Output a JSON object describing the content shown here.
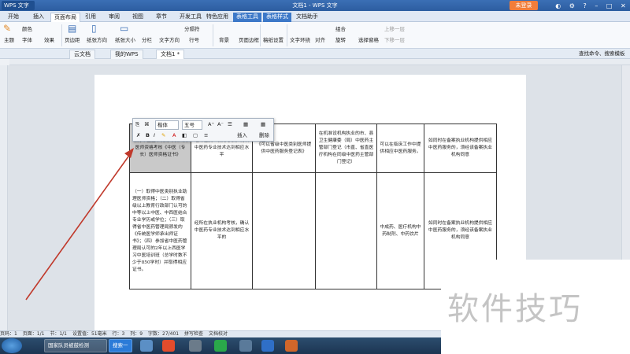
{
  "app": {
    "name": "WPS 文字",
    "doc_title": "文档1 - WPS 文字",
    "login": "未登录"
  },
  "menu_tabs": [
    "开始",
    "插入",
    "页面布局",
    "引用",
    "审阅",
    "视图",
    "章节",
    "开发工具",
    "特色应用",
    "表格工具",
    "表格样式",
    "文档助手"
  ],
  "ribbon": {
    "theme": "主题",
    "color": "颜色",
    "font": "字体",
    "effect": "效果",
    "margins": "页边距",
    "orientation": "纸张方向",
    "size": "纸张大小",
    "columns": "分栏",
    "text_dir": "文字方向",
    "breaks": "分隔符",
    "line_no": "行号",
    "background": "背景",
    "page_border": "页面边框",
    "draft": "稿纸设置",
    "wrap": "文字环绕",
    "align": "对齐",
    "rotate": "旋转",
    "group": "组合",
    "select_pane": "选择窗格",
    "up": "上移一层",
    "down": "下移一层"
  },
  "quickbar": {
    "tabs": [
      "云文档",
      "我的WPS",
      "文档1 *"
    ],
    "search": "查找命令、搜索模板"
  },
  "mini_toolbar": {
    "font": "楷体",
    "size": "五号",
    "insert": "插入",
    "delete": "删除"
  },
  "table": {
    "row1": [
      "取得中医医术确有专长人员医师资格考核《中医（专长）医师资格证书》",
      "经所在执业机构考核，确认中医药专业技术达到相应水平",
      "《可以省级中医类别医师提供中医药服务登记表》",
      "在机准设机构执业的市、县卫生健康委（局）中医药主管部门登记（市直、省直医疗机构在同级中医药主管部门登记）",
      "可以在临床工作中提供相应中医药服务。",
      "如同时在备案执业机构提供相应中医药服务的，须经该备案执业机构同意"
    ],
    "row2": [
      "（一）取得中医类别执业助理医师资格；（二）取得省级以上教育行政部门认可的中等以上中医、中西医结合专业学历或学位；（三）取得省中医药管理局颁发的《传统医学师承出师证书》；（四）参加省中医药管理局认可的2年以上西医学习中医培训班（总学时数不少于850学时）并取得相应证书。",
      "经所在执业机构考核，确认中医药专业技术达到相应水平的",
      "",
      "",
      "中成药、医疗机构中药制剂、中药饮片",
      "如同时在备案执业机构提供相应中医药服务的，须经该备案执业机构同意"
    ]
  },
  "watermark": "软件技巧",
  "status": {
    "page": "页码：1",
    "pages": "页面：1/1",
    "section": "节：1/1",
    "setting": "设置值：51毫米",
    "row": "行：3",
    "col": "列：9",
    "words": "字数：27/401",
    "spell": "拼写检查",
    "check": "文档校对"
  },
  "taskbar": {
    "item1": "国家队员被鼓检测",
    "item2": "搜索一下"
  }
}
